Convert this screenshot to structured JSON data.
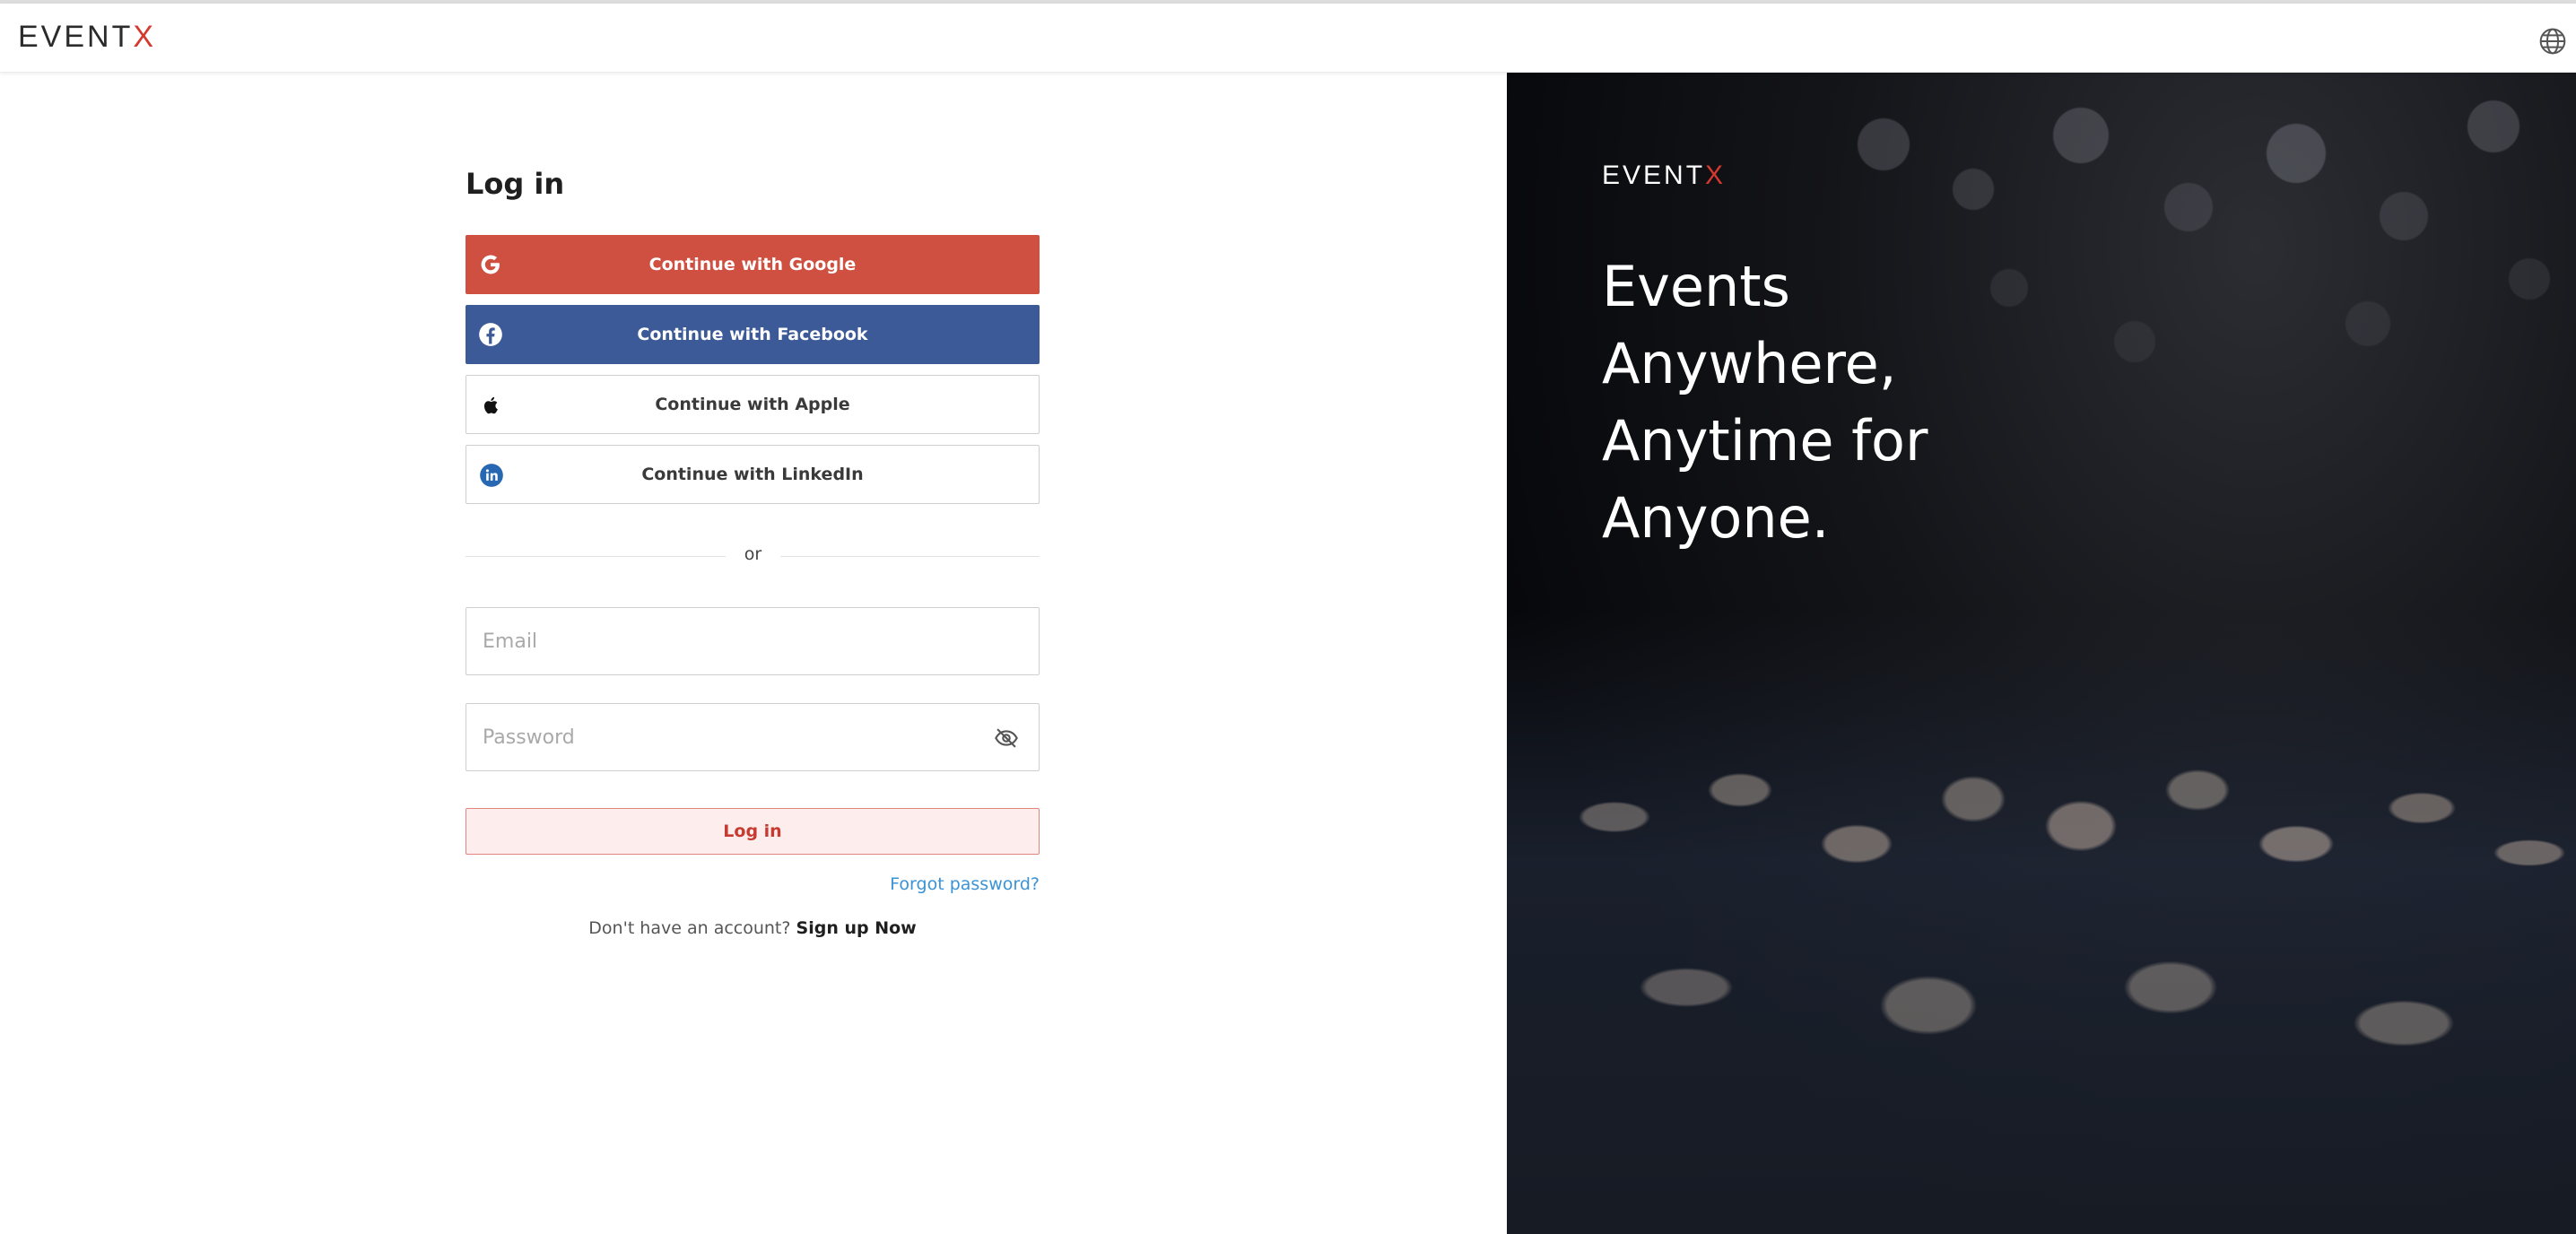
{
  "header": {
    "logo_prefix": "EVENT",
    "logo_x": "X",
    "language_icon": "globe-icon"
  },
  "login": {
    "title": "Log in",
    "google_label": "Continue with Google",
    "facebook_label": "Continue with Facebook",
    "apple_label": "Continue with Apple",
    "linkedin_label": "Continue with LinkedIn",
    "divider_text": "or",
    "email_placeholder": "Email",
    "email_value": "",
    "password_placeholder": "Password",
    "password_value": "",
    "submit_label": "Log in",
    "forgot_label": "Forgot password?",
    "no_account_text": "Don't have an account?",
    "signup_label": "Sign up Now"
  },
  "hero": {
    "logo_prefix": "EVENT",
    "logo_x": "X",
    "tagline_lines": [
      "Events",
      "Anywhere,",
      "Anytime for",
      "Anyone."
    ]
  },
  "colors": {
    "brand_red": "#d5382f",
    "google": "#cf5040",
    "facebook": "#3d5a98",
    "link": "#3a93d6",
    "linkedin": "#2867b2"
  },
  "icons": [
    "globe-icon",
    "google-icon",
    "facebook-icon",
    "apple-icon",
    "linkedin-icon",
    "eye-off-icon"
  ]
}
